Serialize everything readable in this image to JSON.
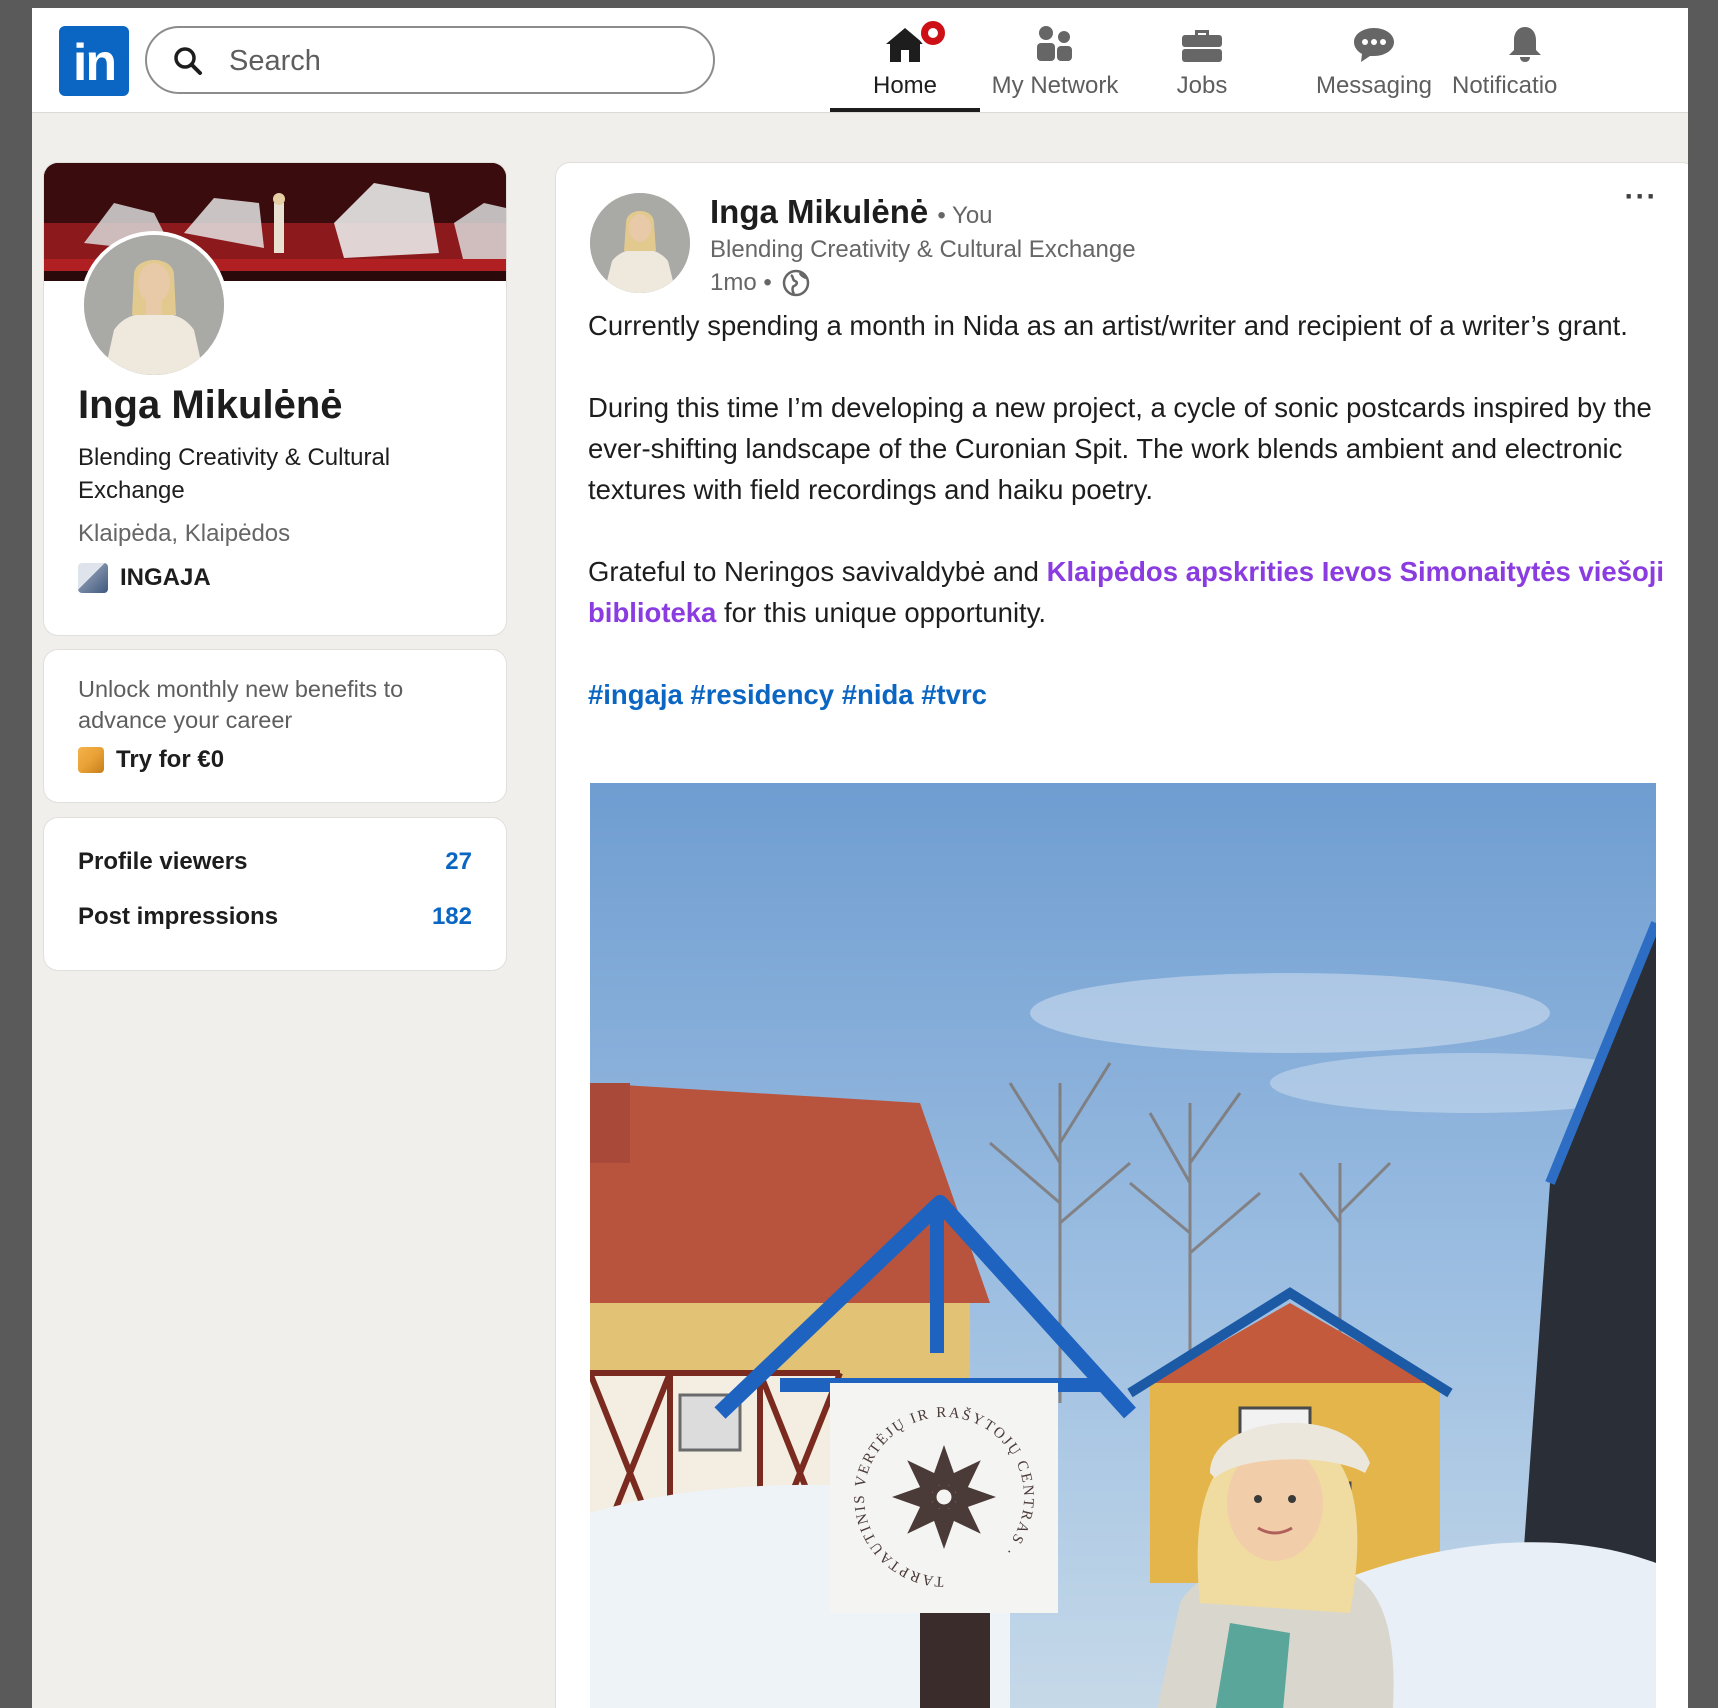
{
  "topbar": {
    "logo_text": "in",
    "search_placeholder": "Search",
    "nav": [
      {
        "label": "Home",
        "icon": "home-icon",
        "active": true,
        "has_badge": true
      },
      {
        "label": "My Network",
        "icon": "network-icon",
        "active": false
      },
      {
        "label": "Jobs",
        "icon": "briefcase-icon",
        "active": false
      },
      {
        "label": "Messaging",
        "icon": "chat-icon",
        "active": false
      },
      {
        "label": "Notificatio",
        "icon": "bell-icon",
        "active": false
      }
    ]
  },
  "profile": {
    "name": "Inga Mikulėnė",
    "headline": "Blending Creativity & Cultural Exchange",
    "location": "Klaipėda, Klaipėdos",
    "company": "INGAJA"
  },
  "premium": {
    "text": "Unlock monthly new benefits to advance your career",
    "cta": "Try for €0"
  },
  "stats": [
    {
      "label": "Profile viewers",
      "value": "27"
    },
    {
      "label": "Post impressions",
      "value": "182"
    }
  ],
  "post": {
    "author": "Inga Mikulėnė",
    "author_suffix": "• You",
    "author_headline": "Blending Creativity & Cultural Exchange",
    "time": "1mo •",
    "more": "···",
    "paragraph1": "Currently spending a month in Nida as an artist/writer and recipient of a writer’s grant.",
    "paragraph2": "During this time I’m developing a new project, a cycle of sonic postcards inspired by the ever-shifting landscape of the Curonian Spit. The work blends ambient and electronic textures with field recordings and haiku poetry.",
    "paragraph3_pre": "Grateful to Neringos savivaldybė and ",
    "paragraph3_mention": "Klaipėdos apskrities Ievos Simonaitytės viešoji biblioteka",
    "paragraph3_post": " for this unique opportunity.",
    "hashtags": "#ingaja #residency #nida #tvrc",
    "image_sign_text": "TARPTAUTINIS VERTĖJŲ IR RAŠYTOJŲ CENTRAS ·"
  },
  "colors": {
    "brand": "#0a66c2",
    "mention": "#8a3ce0",
    "badge": "#cc1016",
    "background": "#f1efeb"
  }
}
